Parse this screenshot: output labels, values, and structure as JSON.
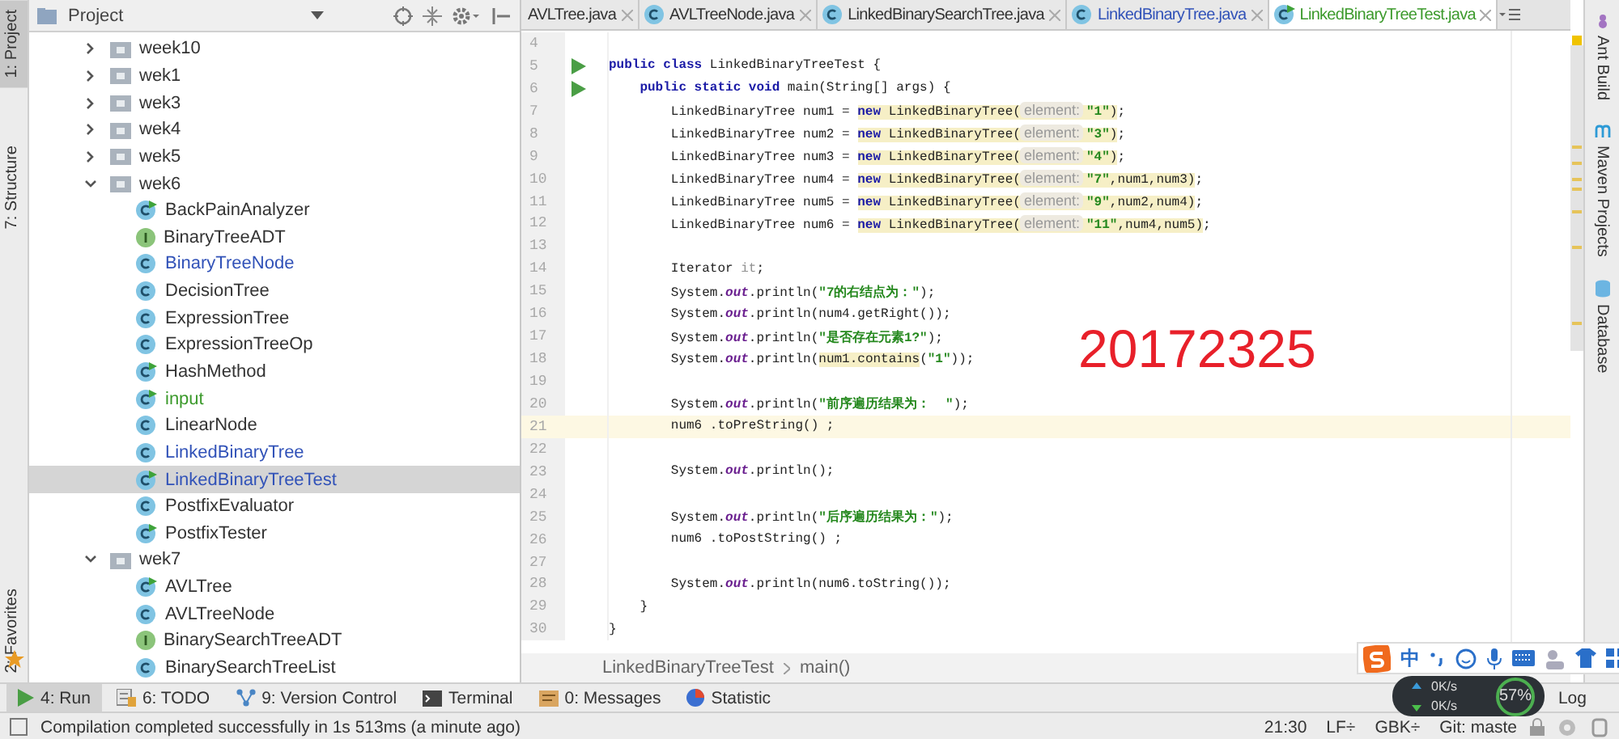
{
  "left_strip": [
    {
      "label": "1: Project",
      "selected": true
    },
    {
      "label": "7: Structure",
      "selected": false
    },
    {
      "label": "2: Favorites",
      "selected": false
    }
  ],
  "project_panel": {
    "title": "Project",
    "tree": [
      {
        "label": "week10",
        "kind": "folder",
        "color": "#333333",
        "expanded": false,
        "selected": false
      },
      {
        "label": "wek1",
        "kind": "folder",
        "color": "#333333",
        "expanded": false,
        "selected": false
      },
      {
        "label": "wek3",
        "kind": "folder",
        "color": "#333333",
        "expanded": false,
        "selected": false
      },
      {
        "label": "wek4",
        "kind": "folder",
        "color": "#333333",
        "expanded": false,
        "selected": false
      },
      {
        "label": "wek5",
        "kind": "folder",
        "color": "#333333",
        "expanded": false,
        "selected": false
      },
      {
        "label": "wek6",
        "kind": "folder",
        "color": "#333333",
        "expanded": true,
        "selected": false,
        "children": [
          {
            "label": "BackPainAnalyzer",
            "kind": "runnable",
            "color": "#333333",
            "selected": false
          },
          {
            "label": "BinaryTreeADT",
            "kind": "interface",
            "color": "#333333",
            "selected": false
          },
          {
            "label": "BinaryTreeNode",
            "kind": "class",
            "color": "#3152b8",
            "selected": false
          },
          {
            "label": "DecisionTree",
            "kind": "class",
            "color": "#333333",
            "selected": false
          },
          {
            "label": "ExpressionTree",
            "kind": "class",
            "color": "#333333",
            "selected": false
          },
          {
            "label": "ExpressionTreeOp",
            "kind": "class",
            "color": "#333333",
            "selected": false
          },
          {
            "label": "HashMethod",
            "kind": "runnable",
            "color": "#333333",
            "selected": false
          },
          {
            "label": "input",
            "kind": "runnable",
            "color": "#3c9a2c",
            "selected": false
          },
          {
            "label": "LinearNode",
            "kind": "class",
            "color": "#333333",
            "selected": false
          },
          {
            "label": "LinkedBinaryTree",
            "kind": "class",
            "color": "#3152b8",
            "selected": false
          },
          {
            "label": "LinkedBinaryTreeTest",
            "kind": "runnable",
            "color": "#3152b8",
            "selected": true
          },
          {
            "label": "PostfixEvaluator",
            "kind": "class",
            "color": "#333333",
            "selected": false
          },
          {
            "label": "PostfixTester",
            "kind": "runnable",
            "color": "#333333",
            "selected": false
          }
        ]
      },
      {
        "label": "wek7",
        "kind": "folder",
        "color": "#333333",
        "expanded": true,
        "selected": false,
        "children": [
          {
            "label": "AVLTree",
            "kind": "runnable",
            "color": "#333333",
            "selected": false
          },
          {
            "label": "AVLTreeNode",
            "kind": "class",
            "color": "#333333",
            "selected": false
          },
          {
            "label": "BinarySearchTreeADT",
            "kind": "interface",
            "color": "#333333",
            "selected": false
          },
          {
            "label": "BinarySearchTreeList",
            "kind": "class",
            "color": "#333333",
            "selected": false
          }
        ]
      }
    ]
  },
  "tabs": [
    {
      "label": "AVLTree.java",
      "color": "#333333",
      "selected": false
    },
    {
      "label": "AVLTreeNode.java",
      "color": "#333333",
      "selected": false
    },
    {
      "label": "LinkedBinarySearchTree.java",
      "color": "#333333",
      "selected": false
    },
    {
      "label": "LinkedBinaryTree.java",
      "color": "#3152b8",
      "selected": false
    },
    {
      "label": "LinkedBinaryTreeTest.java",
      "color": "#3c9a2c",
      "selected": true
    }
  ],
  "editor": {
    "lines": [
      {
        "number": "4",
        "run": false,
        "current": false
      },
      {
        "number": "5",
        "run": true,
        "current": false,
        "segments": [
          {
            "kind": "kw",
            "text": "public class "
          },
          {
            "kind": "plain",
            "text": "LinkedBinaryTreeTest {"
          }
        ]
      },
      {
        "number": "6",
        "run": true,
        "current": false,
        "segments": [
          {
            "kind": "kw",
            "text": "    public static void "
          },
          {
            "kind": "plain",
            "text": "main(String[] args) {"
          }
        ]
      },
      {
        "number": "7",
        "run": false,
        "current": false,
        "segments": [
          {
            "kind": "plain",
            "text": "        LinkedBinaryTree num1 = "
          },
          {
            "kind": "warn",
            "children": [
              {
                "kind": "kw",
                "text": "new"
              },
              {
                "kind": "plain",
                "text": " LinkedBinaryTree("
              },
              {
                "kind": "hint",
                "text": "element:"
              },
              {
                "kind": "str",
                "text": "\"1\""
              },
              {
                "kind": "plain",
                "text": ")"
              }
            ]
          },
          {
            "kind": "plain",
            "text": ";"
          }
        ]
      },
      {
        "number": "8",
        "run": false,
        "current": false,
        "segments": [
          {
            "kind": "plain",
            "text": "        LinkedBinaryTree num2 = "
          },
          {
            "kind": "warn",
            "children": [
              {
                "kind": "kw",
                "text": "new"
              },
              {
                "kind": "plain",
                "text": " LinkedBinaryTree("
              },
              {
                "kind": "hint",
                "text": "element:"
              },
              {
                "kind": "str",
                "text": "\"3\""
              },
              {
                "kind": "plain",
                "text": ")"
              }
            ]
          },
          {
            "kind": "plain",
            "text": ";"
          }
        ]
      },
      {
        "number": "9",
        "run": false,
        "current": false,
        "segments": [
          {
            "kind": "plain",
            "text": "        LinkedBinaryTree num3 = "
          },
          {
            "kind": "warn",
            "children": [
              {
                "kind": "kw",
                "text": "new"
              },
              {
                "kind": "plain",
                "text": " LinkedBinaryTree("
              },
              {
                "kind": "hint",
                "text": "element:"
              },
              {
                "kind": "str",
                "text": "\"4\""
              },
              {
                "kind": "plain",
                "text": ")"
              }
            ]
          },
          {
            "kind": "plain",
            "text": ";"
          }
        ]
      },
      {
        "number": "10",
        "run": false,
        "current": false,
        "segments": [
          {
            "kind": "plain",
            "text": "        LinkedBinaryTree num4 = "
          },
          {
            "kind": "warn",
            "children": [
              {
                "kind": "kw",
                "text": "new"
              },
              {
                "kind": "plain",
                "text": " LinkedBinaryTree("
              },
              {
                "kind": "hint",
                "text": "element:"
              },
              {
                "kind": "str",
                "text": "\"7\""
              },
              {
                "kind": "plain",
                "text": ",num1,num3)"
              }
            ]
          },
          {
            "kind": "plain",
            "text": ";"
          }
        ]
      },
      {
        "number": "11",
        "run": false,
        "current": false,
        "segments": [
          {
            "kind": "plain",
            "text": "        LinkedBinaryTree num5 = "
          },
          {
            "kind": "warn",
            "children": [
              {
                "kind": "kw",
                "text": "new"
              },
              {
                "kind": "plain",
                "text": " LinkedBinaryTree("
              },
              {
                "kind": "hint",
                "text": "element:"
              },
              {
                "kind": "str",
                "text": "\"9\""
              },
              {
                "kind": "plain",
                "text": ",num2,num4)"
              }
            ]
          },
          {
            "kind": "plain",
            "text": ";"
          }
        ]
      },
      {
        "number": "12",
        "run": false,
        "current": false,
        "segments": [
          {
            "kind": "plain",
            "text": "        LinkedBinaryTree num6 = "
          },
          {
            "kind": "warn",
            "children": [
              {
                "kind": "kw",
                "text": "new"
              },
              {
                "kind": "plain",
                "text": " LinkedBinaryTree("
              },
              {
                "kind": "hint",
                "text": "element:"
              },
              {
                "kind": "str",
                "text": "\"11\""
              },
              {
                "kind": "plain",
                "text": ",num4,num5)"
              }
            ]
          },
          {
            "kind": "plain",
            "text": ";"
          }
        ]
      },
      {
        "number": "13",
        "run": false,
        "current": false
      },
      {
        "number": "14",
        "run": false,
        "current": false,
        "segments": [
          {
            "kind": "plain",
            "text": "        Iterator "
          },
          {
            "kind": "unused",
            "text": "it"
          },
          {
            "kind": "plain",
            "text": ";"
          }
        ]
      },
      {
        "number": "15",
        "run": false,
        "current": false,
        "segments": [
          {
            "kind": "plain",
            "text": "        System."
          },
          {
            "kind": "field",
            "text": "out"
          },
          {
            "kind": "plain",
            "text": ".println("
          },
          {
            "kind": "str",
            "text": "\"7的右结点为：\""
          },
          {
            "kind": "plain",
            "text": ");"
          }
        ]
      },
      {
        "number": "16",
        "run": false,
        "current": false,
        "segments": [
          {
            "kind": "plain",
            "text": "        System."
          },
          {
            "kind": "field",
            "text": "out"
          },
          {
            "kind": "plain",
            "text": ".println(num4.getRight());"
          }
        ]
      },
      {
        "number": "17",
        "run": false,
        "current": false,
        "segments": [
          {
            "kind": "plain",
            "text": "        System."
          },
          {
            "kind": "field",
            "text": "out"
          },
          {
            "kind": "plain",
            "text": ".println("
          },
          {
            "kind": "str",
            "text": "\"是否存在元素1?\""
          },
          {
            "kind": "plain",
            "text": ");"
          }
        ]
      },
      {
        "number": "18",
        "run": false,
        "current": false,
        "segments": [
          {
            "kind": "plain",
            "text": "        System."
          },
          {
            "kind": "field",
            "text": "out"
          },
          {
            "kind": "plain",
            "text": ".println("
          },
          {
            "kind": "warn",
            "children": [
              {
                "kind": "plain",
                "text": "num1.contains"
              }
            ]
          },
          {
            "kind": "plain",
            "text": "("
          },
          {
            "kind": "str",
            "text": "\"1\""
          },
          {
            "kind": "plain",
            "text": "));"
          }
        ]
      },
      {
        "number": "19",
        "run": false,
        "current": false
      },
      {
        "number": "20",
        "run": false,
        "current": false,
        "segments": [
          {
            "kind": "plain",
            "text": "        System."
          },
          {
            "kind": "field",
            "text": "out"
          },
          {
            "kind": "plain",
            "text": ".println("
          },
          {
            "kind": "str",
            "text": "\"前序遍历结果为：  \""
          },
          {
            "kind": "plain",
            "text": ");"
          }
        ]
      },
      {
        "number": "21",
        "run": false,
        "current": true,
        "segments": [
          {
            "kind": "plain",
            "text": "        num6 .toPreString() ;"
          }
        ]
      },
      {
        "number": "22",
        "run": false,
        "current": false
      },
      {
        "number": "23",
        "run": false,
        "current": false,
        "segments": [
          {
            "kind": "plain",
            "text": "        System."
          },
          {
            "kind": "field",
            "text": "out"
          },
          {
            "kind": "plain",
            "text": ".println();"
          }
        ]
      },
      {
        "number": "24",
        "run": false,
        "current": false
      },
      {
        "number": "25",
        "run": false,
        "current": false,
        "segments": [
          {
            "kind": "plain",
            "text": "        System."
          },
          {
            "kind": "field",
            "text": "out"
          },
          {
            "kind": "plain",
            "text": ".println("
          },
          {
            "kind": "str",
            "text": "\"后序遍历结果为：\""
          },
          {
            "kind": "plain",
            "text": ");"
          }
        ]
      },
      {
        "number": "26",
        "run": false,
        "current": false,
        "segments": [
          {
            "kind": "plain",
            "text": "        num6 .toPostString() ;"
          }
        ]
      },
      {
        "number": "27",
        "run": false,
        "current": false
      },
      {
        "number": "28",
        "run": false,
        "current": false,
        "segments": [
          {
            "kind": "plain",
            "text": "        System."
          },
          {
            "kind": "field",
            "text": "out"
          },
          {
            "kind": "plain",
            "text": ".println(num6.toString());"
          }
        ]
      },
      {
        "number": "29",
        "run": false,
        "current": false,
        "segments": [
          {
            "kind": "plain",
            "text": "    }"
          }
        ]
      },
      {
        "number": "30",
        "run": false,
        "current": false,
        "segments": [
          {
            "kind": "plain",
            "text": "}"
          }
        ]
      }
    ],
    "overlay_text": "20172325",
    "breadcrumb": [
      "LinkedBinaryTreeTest",
      "main()"
    ]
  },
  "right_strip": [
    "Ant Build",
    "Maven Projects",
    "Database"
  ],
  "tool_bar": [
    {
      "label": "4: Run",
      "kind": "run",
      "selected": true
    },
    {
      "label": "6: TODO",
      "kind": "todo",
      "selected": false
    },
    {
      "label": "9: Version Control",
      "kind": "vcs",
      "selected": false
    },
    {
      "label": "Terminal",
      "kind": "terminal",
      "selected": false
    },
    {
      "label": "0: Messages",
      "kind": "messages",
      "selected": false
    },
    {
      "label": "Statistic",
      "kind": "statistic",
      "selected": false
    }
  ],
  "tool_bar_right": "Log",
  "status_bar": {
    "message": "Compilation completed successfully in 1s 513ms (a minute ago)",
    "items": [
      "21:30",
      "LF÷",
      "GBK÷",
      "Git: maste"
    ]
  },
  "ime_bar": {
    "mode": "中"
  },
  "net_widget": {
    "upload": "0K/s",
    "download": "0K/s",
    "percent": "57%"
  }
}
